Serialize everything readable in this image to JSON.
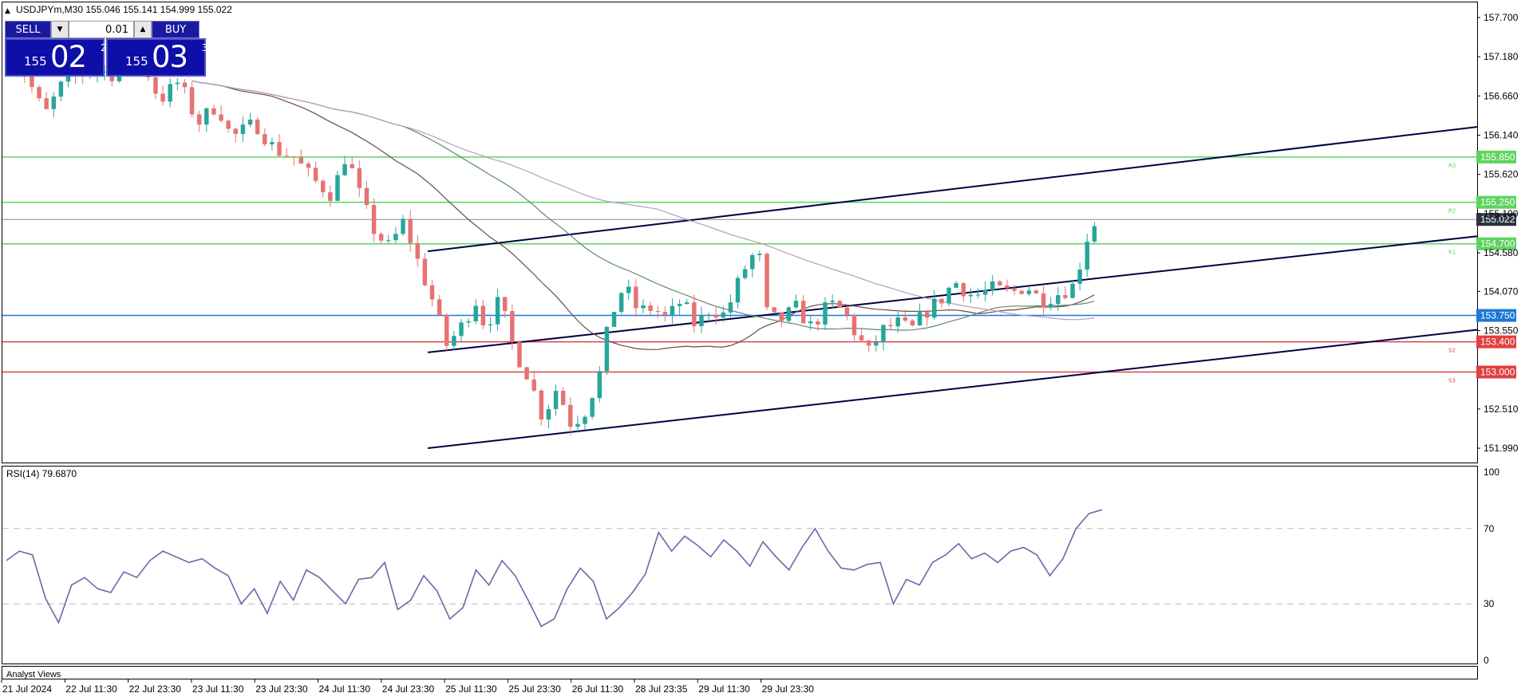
{
  "symbol_header": {
    "title": "USDJPYm,M30  155.046 155.141 154.999 155.022"
  },
  "trade_panel": {
    "sell_label": "SELL",
    "buy_label": "BUY",
    "lot": "0.01",
    "sell_quote": {
      "prefix": "155",
      "big": "02",
      "sup": "2"
    },
    "buy_quote": {
      "prefix": "155",
      "big": "03",
      "sup": "3"
    }
  },
  "rsi_panel": {
    "title": "RSI(14) 79.6870"
  },
  "bottom_panel": {
    "title": "Analyst Views"
  },
  "colors": {
    "bull": "#26a69a",
    "bear": "#e57373",
    "resistance": "#5fd35f",
    "support": "#e04040",
    "pivot": "#1e78d6",
    "price_label": "#2b3440",
    "rsi_line": "#7b5fa8",
    "trendline": "#000044"
  },
  "chart_data": {
    "type": "candlestick",
    "symbol": "USDJPYm",
    "timeframe": "M30",
    "ylim": [
      151.8,
      157.9
    ],
    "y_ticks": [
      "157.700",
      "157.180",
      "156.660",
      "156.140",
      "155.620",
      "155.100",
      "154.580",
      "154.070",
      "153.550",
      "152.510",
      "151.990"
    ],
    "x_ticks": [
      "21 Jul 2024",
      "22 Jul 11:30",
      "22 Jul 23:30",
      "23 Jul 11:30",
      "23 Jul 23:30",
      "24 Jul 11:30",
      "24 Jul 23:30",
      "25 Jul 11:30",
      "25 Jul 23:30",
      "26 Jul 11:30",
      "28 Jul 23:35",
      "29 Jul 11:30",
      "29 Jul 23:30"
    ],
    "current_price": "155.022",
    "levels": [
      {
        "price": 155.85,
        "label": "155.850",
        "kind": "resistance",
        "tag": "R3"
      },
      {
        "price": 155.25,
        "label": "155.250",
        "kind": "resistance",
        "tag": "R2"
      },
      {
        "price": 154.7,
        "label": "154.700",
        "kind": "resistance",
        "tag": "R1"
      },
      {
        "price": 153.75,
        "label": "153.750",
        "kind": "pivot",
        "tag": ""
      },
      {
        "price": 153.4,
        "label": "153.400",
        "kind": "support",
        "tag": "S2"
      },
      {
        "price": 153.0,
        "label": "153.000",
        "kind": "support",
        "tag": "S3"
      }
    ],
    "channel": [
      {
        "x0": 0.44,
        "y0": 154.6,
        "x1": 1.0,
        "y1": 156.25
      },
      {
        "x0": 0.44,
        "y0": 153.26,
        "x1": 1.0,
        "y1": 154.8
      },
      {
        "x0": 0.44,
        "y0": 151.99,
        "x1": 1.0,
        "y1": 153.56
      }
    ],
    "price_path": [
      [
        0.0,
        157.15
      ],
      [
        0.02,
        156.95
      ],
      [
        0.04,
        156.4
      ],
      [
        0.06,
        156.85
      ],
      [
        0.09,
        157.0
      ],
      [
        0.11,
        156.95
      ],
      [
        0.14,
        157.2
      ],
      [
        0.16,
        156.6
      ],
      [
        0.18,
        156.85
      ],
      [
        0.2,
        156.3
      ],
      [
        0.22,
        156.55
      ],
      [
        0.235,
        156.1
      ],
      [
        0.26,
        156.3
      ],
      [
        0.28,
        155.95
      ],
      [
        0.3,
        155.85
      ],
      [
        0.32,
        155.55
      ],
      [
        0.34,
        155.35
      ],
      [
        0.355,
        155.9
      ],
      [
        0.37,
        155.3
      ],
      [
        0.385,
        154.85
      ],
      [
        0.4,
        154.65
      ],
      [
        0.415,
        155.0
      ],
      [
        0.43,
        154.45
      ],
      [
        0.445,
        153.95
      ],
      [
        0.46,
        153.35
      ],
      [
        0.475,
        153.6
      ],
      [
        0.49,
        153.95
      ],
      [
        0.5,
        153.6
      ],
      [
        0.515,
        153.95
      ],
      [
        0.53,
        153.3
      ],
      [
        0.545,
        152.95
      ],
      [
        0.56,
        152.4
      ],
      [
        0.575,
        152.8
      ],
      [
        0.59,
        152.3
      ],
      [
        0.605,
        152.5
      ],
      [
        0.62,
        153.0
      ],
      [
        0.63,
        153.7
      ],
      [
        0.645,
        154.15
      ],
      [
        0.66,
        153.8
      ],
      [
        0.675,
        153.85
      ],
      [
        0.69,
        153.7
      ],
      [
        0.705,
        153.95
      ],
      [
        0.72,
        153.6
      ],
      [
        0.735,
        153.85
      ],
      [
        0.75,
        153.75
      ],
      [
        0.77,
        154.35
      ],
      [
        0.785,
        154.65
      ],
      [
        0.795,
        153.7
      ],
      [
        0.81,
        153.7
      ],
      [
        0.825,
        153.85
      ],
      [
        0.84,
        153.6
      ],
      [
        0.86,
        153.9
      ],
      [
        0.875,
        153.8
      ],
      [
        0.885,
        153.55
      ],
      [
        0.9,
        153.25
      ],
      [
        0.915,
        153.55
      ],
      [
        0.93,
        153.65
      ],
      [
        0.945,
        153.55
      ],
      [
        0.96,
        153.8
      ],
      [
        0.975,
        153.95
      ],
      [
        0.99,
        154.2
      ],
      [
        1.01,
        154.0
      ],
      [
        1.03,
        154.1
      ],
      [
        1.05,
        154.05
      ],
      [
        1.065,
        154.15
      ],
      [
        1.08,
        153.95
      ],
      [
        1.1,
        154.05
      ],
      [
        1.115,
        154.15
      ],
      [
        1.13,
        154.85
      ],
      [
        1.14,
        155.05
      ]
    ],
    "rsi": {
      "period": 14,
      "value": 79.687,
      "levels": [
        70,
        30
      ],
      "ylim": [
        0,
        100
      ],
      "y_ticks": [
        "100",
        "70",
        "30",
        "0"
      ],
      "values": [
        53,
        58,
        56,
        33,
        20,
        40,
        44,
        38,
        36,
        47,
        44,
        53,
        58,
        55,
        52,
        54,
        49,
        45,
        30,
        38,
        25,
        42,
        32,
        48,
        44,
        37,
        30,
        43,
        44,
        52,
        27,
        32,
        45,
        37,
        22,
        28,
        48,
        40,
        53,
        45,
        32,
        18,
        22,
        38,
        49,
        42,
        22,
        28,
        36,
        46,
        68,
        58,
        66,
        61,
        55,
        64,
        58,
        50,
        63,
        55,
        48,
        60,
        70,
        58,
        49,
        48,
        51,
        52,
        30,
        43,
        40,
        52,
        56,
        62,
        54,
        57,
        52,
        58,
        60,
        56,
        45,
        54,
        70,
        78,
        80
      ]
    }
  }
}
